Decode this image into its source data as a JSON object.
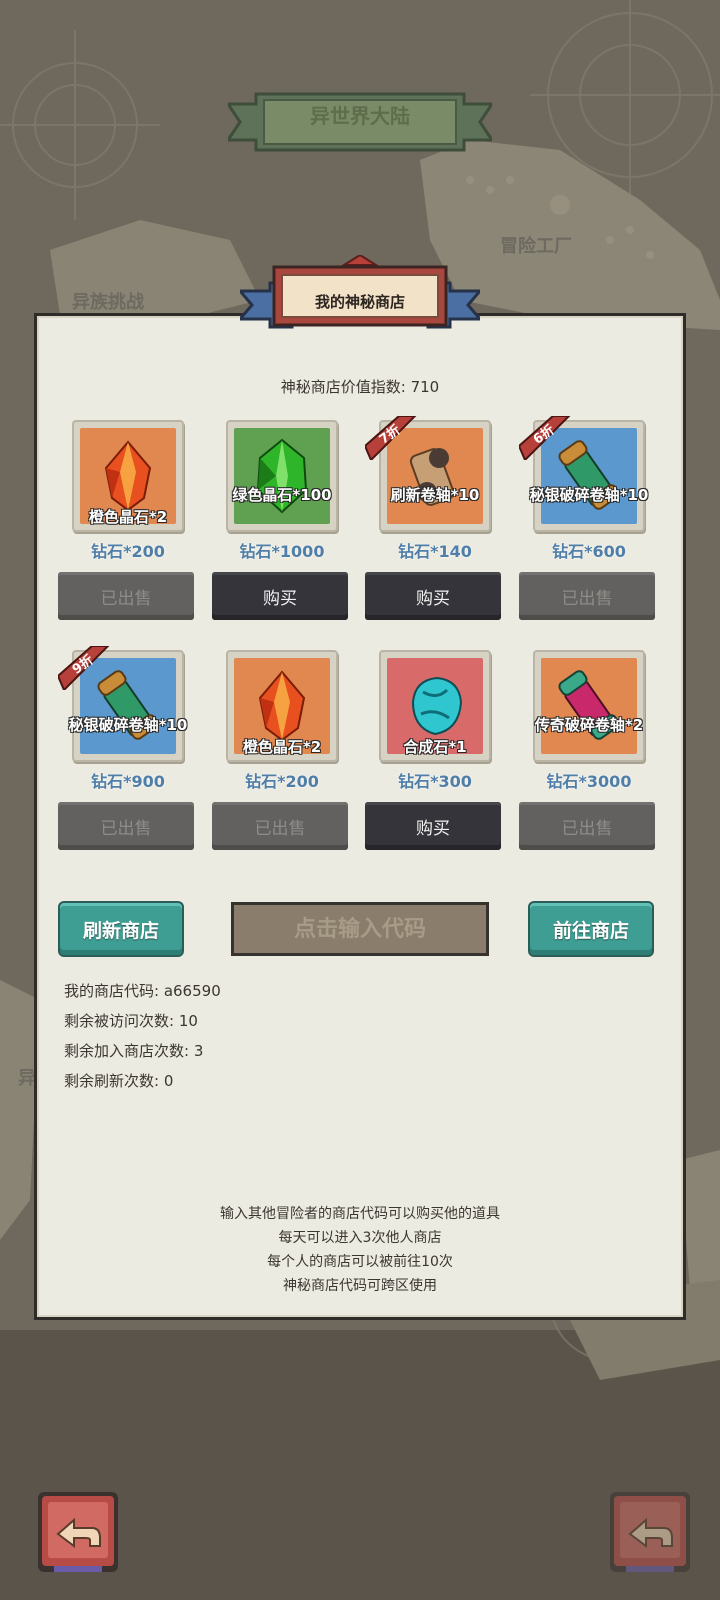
{
  "map": {
    "title": "异世界大陆",
    "labels": [
      "冒险工厂",
      "异族挑战",
      "异"
    ]
  },
  "shop": {
    "title": "我的神秘商店",
    "value_index_label": "神秘商店价值指数: 710",
    "items": [
      {
        "name": "橙色晶石*2",
        "price": "钻石*200",
        "button": "已出售",
        "state": "sold",
        "discount": "",
        "color": "#e0884f",
        "icon": "orange-crystal-icon"
      },
      {
        "name": "绿色晶石*100",
        "price": "钻石*1000",
        "button": "购买",
        "state": "buy",
        "discount": "",
        "color": "#5fa151",
        "icon": "green-crystal-icon"
      },
      {
        "name": "刷新卷轴*10",
        "price": "钻石*140",
        "button": "购买",
        "state": "buy",
        "discount": "7折",
        "color": "#e0884f",
        "icon": "refresh-scroll-icon"
      },
      {
        "name": "秘银破碎卷轴*10",
        "price": "钻石*600",
        "button": "已出售",
        "state": "sold",
        "discount": "6折",
        "color": "#5b98cd",
        "icon": "mithril-scroll-icon"
      },
      {
        "name": "秘银破碎卷轴*10",
        "price": "钻石*900",
        "button": "已出售",
        "state": "sold",
        "discount": "9折",
        "color": "#5b98cd",
        "icon": "mithril-scroll-icon"
      },
      {
        "name": "橙色晶石*2",
        "price": "钻石*200",
        "button": "已出售",
        "state": "sold",
        "discount": "",
        "color": "#e0884f",
        "icon": "orange-crystal-icon"
      },
      {
        "name": "合成石*1",
        "price": "钻石*300",
        "button": "购买",
        "state": "buy",
        "discount": "",
        "color": "#d96a6a",
        "icon": "synthesis-stone-icon"
      },
      {
        "name": "传奇破碎卷轴*2",
        "price": "钻石*3000",
        "button": "已出售",
        "state": "sold",
        "discount": "",
        "color": "#e0884f",
        "icon": "legendary-scroll-icon"
      }
    ],
    "refresh_button": "刷新商店",
    "code_placeholder": "点击输入代码",
    "goto_button": "前往商店",
    "stats": {
      "my_code": "我的商店代码: a66590",
      "visits_left": "剩余被访问次数: 10",
      "joins_left": "剩余加入商店次数: 3",
      "refresh_left": "剩余刷新次数: 0"
    },
    "notes": [
      "输入其他冒险者的商店代码可以购买他的道具",
      "每天可以进入3次他人商店",
      "每个人的商店可以被前往10次",
      "神秘商店代码可跨区使用"
    ]
  },
  "colors": {
    "teal": "#3f9e93",
    "price_blue": "#4f7ea8",
    "discount_red": "#b8403a"
  }
}
